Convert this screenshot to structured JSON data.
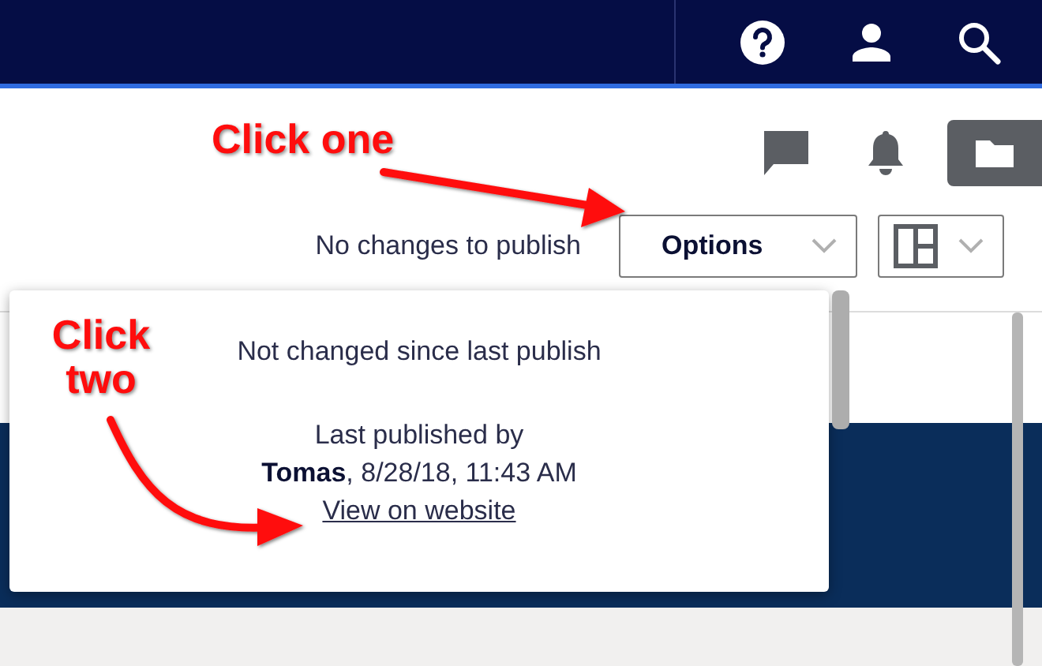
{
  "toolbar": {
    "status": "No changes to publish",
    "options_button": {
      "label": "Options"
    }
  },
  "popup": {
    "message": "Not changed since last publish",
    "published_label": "Last published by",
    "published_detail": "**Tomas**, 8/28/18, 11:43 AM",
    "link": "View on website"
  },
  "annotations": [
    {
      "text": "Click one"
    },
    {
      "text": "Click two"
    }
  ]
}
